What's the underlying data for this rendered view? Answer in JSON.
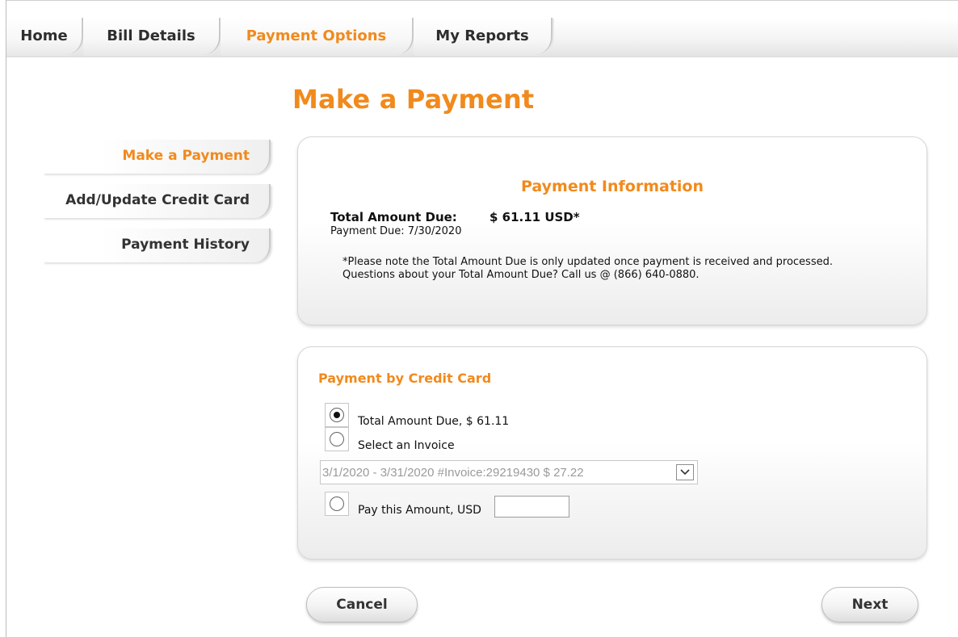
{
  "nav": {
    "tabs": [
      {
        "label": "Home"
      },
      {
        "label": "Bill Details"
      },
      {
        "label": "Payment Options"
      },
      {
        "label": "My Reports"
      }
    ],
    "active_tab": "Payment Options"
  },
  "page_title": "Make a Payment",
  "sidenav": {
    "items": [
      {
        "label": "Make a Payment"
      },
      {
        "label": "Add/Update Credit Card"
      },
      {
        "label": "Payment History"
      }
    ],
    "active_item": "Make a Payment"
  },
  "payment_info": {
    "title": "Payment Information",
    "total_label": "Total Amount Due:",
    "total_value": "$ 61.11 USD*",
    "due_date": "Payment Due: 7/30/2020",
    "note": "*Please note the Total Amount Due is only updated once payment is received and processed. Questions about your Total Amount Due? Call us @ (866) 640-0880."
  },
  "credit_card": {
    "title": "Payment by Credit Card",
    "options": [
      {
        "label": "Total Amount Due, $ 61.11",
        "checked": true
      },
      {
        "label": "Select an Invoice",
        "checked": false
      },
      {
        "label": "Pay this Amount, USD",
        "checked": false
      }
    ],
    "invoice_select": {
      "selected": "3/1/2020 - 3/31/2020 #Invoice:29219430 $ 27.22"
    },
    "amount_input": {
      "value": ""
    }
  },
  "buttons": {
    "cancel": "Cancel",
    "next": "Next"
  },
  "colors": {
    "accent": "#f18a1c",
    "text": "#333333"
  }
}
